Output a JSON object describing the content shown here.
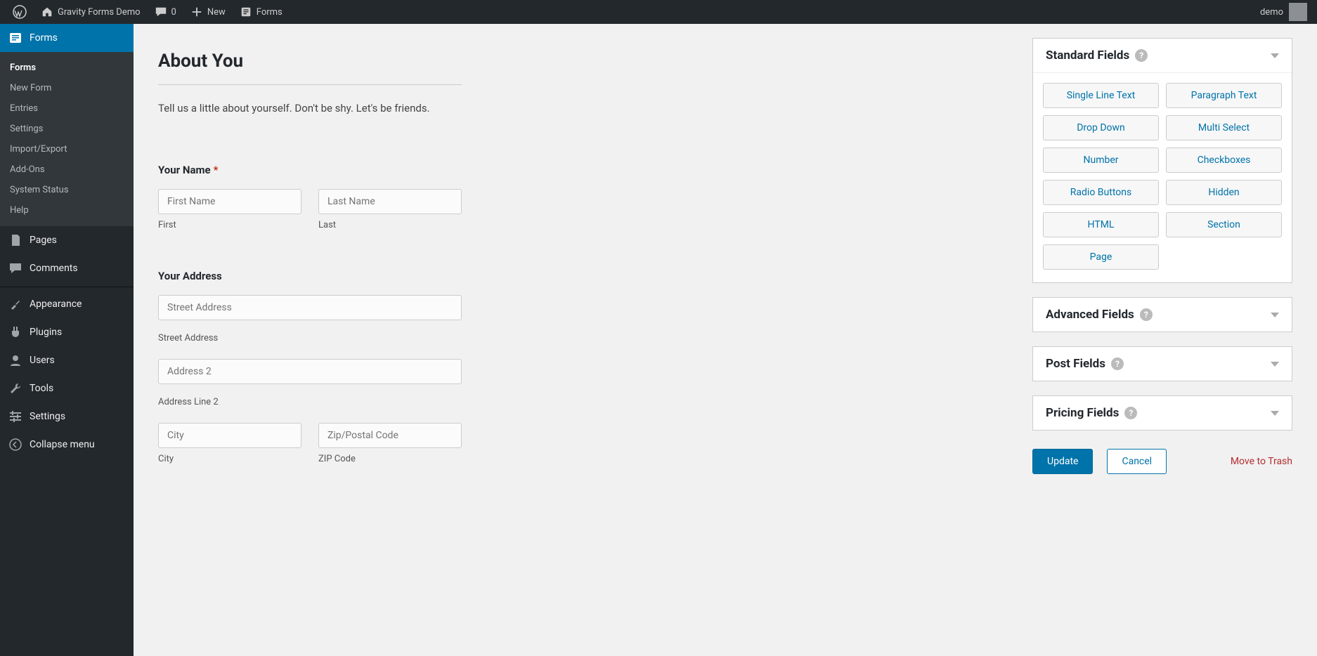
{
  "adminbar": {
    "site_name": "Gravity Forms Demo",
    "comments_count": "0",
    "new_label": "New",
    "forms_label": "Forms",
    "user_name": "demo"
  },
  "sidebar": {
    "active_label": "Forms",
    "submenu": [
      "Forms",
      "New Form",
      "Entries",
      "Settings",
      "Import/Export",
      "Add-Ons",
      "System Status",
      "Help"
    ],
    "items": [
      {
        "key": "pages",
        "label": "Pages"
      },
      {
        "key": "comments",
        "label": "Comments"
      },
      {
        "key": "appearance",
        "label": "Appearance"
      },
      {
        "key": "plugins",
        "label": "Plugins"
      },
      {
        "key": "users",
        "label": "Users"
      },
      {
        "key": "tools",
        "label": "Tools"
      },
      {
        "key": "settings",
        "label": "Settings"
      },
      {
        "key": "collapse",
        "label": "Collapse menu"
      }
    ]
  },
  "form": {
    "title": "About You",
    "description": "Tell us a little about yourself. Don't be shy. Let's be friends.",
    "name_label": "Your Name",
    "first_ph": "First Name",
    "first_sub": "First",
    "last_ph": "Last Name",
    "last_sub": "Last",
    "address_label": "Your Address",
    "street_ph": "Street Address",
    "street_sub": "Street Address",
    "addr2_ph": "Address 2",
    "addr2_sub": "Address Line 2",
    "city_ph": "City",
    "city_sub": "City",
    "zip_ph": "Zip/Postal Code",
    "zip_sub": "ZIP Code"
  },
  "panels": {
    "standard": {
      "title": "Standard Fields",
      "buttons": [
        "Single Line Text",
        "Paragraph Text",
        "Drop Down",
        "Multi Select",
        "Number",
        "Checkboxes",
        "Radio Buttons",
        "Hidden",
        "HTML",
        "Section",
        "Page"
      ]
    },
    "advanced": {
      "title": "Advanced Fields"
    },
    "post": {
      "title": "Post Fields"
    },
    "pricing": {
      "title": "Pricing Fields"
    }
  },
  "actions": {
    "update": "Update",
    "cancel": "Cancel",
    "trash": "Move to Trash"
  }
}
